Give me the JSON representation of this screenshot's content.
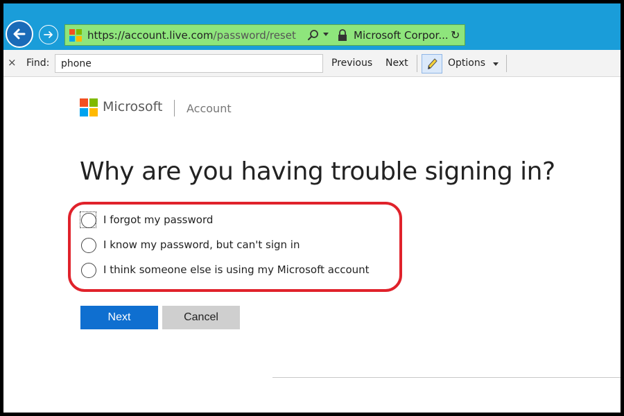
{
  "browser": {
    "url_host": "https://account.live.com",
    "url_path": "/password/reset",
    "site_identity": "Microsoft Corpor...",
    "refresh_glyph": "↻",
    "back_icon": "back-arrow-icon",
    "forward_icon": "forward-arrow-icon"
  },
  "findbar": {
    "close_glyph": "×",
    "label": "Find:",
    "query": "phone",
    "previous": "Previous",
    "next": "Next",
    "options": "Options"
  },
  "brand": {
    "name": "Microsoft",
    "section": "Account",
    "logo_colors": [
      "#f25022",
      "#7fba00",
      "#00a4ef",
      "#ffb900"
    ]
  },
  "page": {
    "heading": "Why are you having trouble signing in?",
    "options": [
      {
        "label": "I forgot my password",
        "selected": false,
        "focused": true
      },
      {
        "label": "I know my password, but can't sign in",
        "selected": false,
        "focused": false
      },
      {
        "label": "I think someone else is using my Microsoft account",
        "selected": false,
        "focused": false
      }
    ],
    "next_button": "Next",
    "cancel_button": "Cancel"
  },
  "colors": {
    "accent": "#0f6fd0",
    "highlight_border": "#e0222b",
    "urlbar_secure": "#8ee57c",
    "browser_chrome": "#1a9dd9"
  }
}
